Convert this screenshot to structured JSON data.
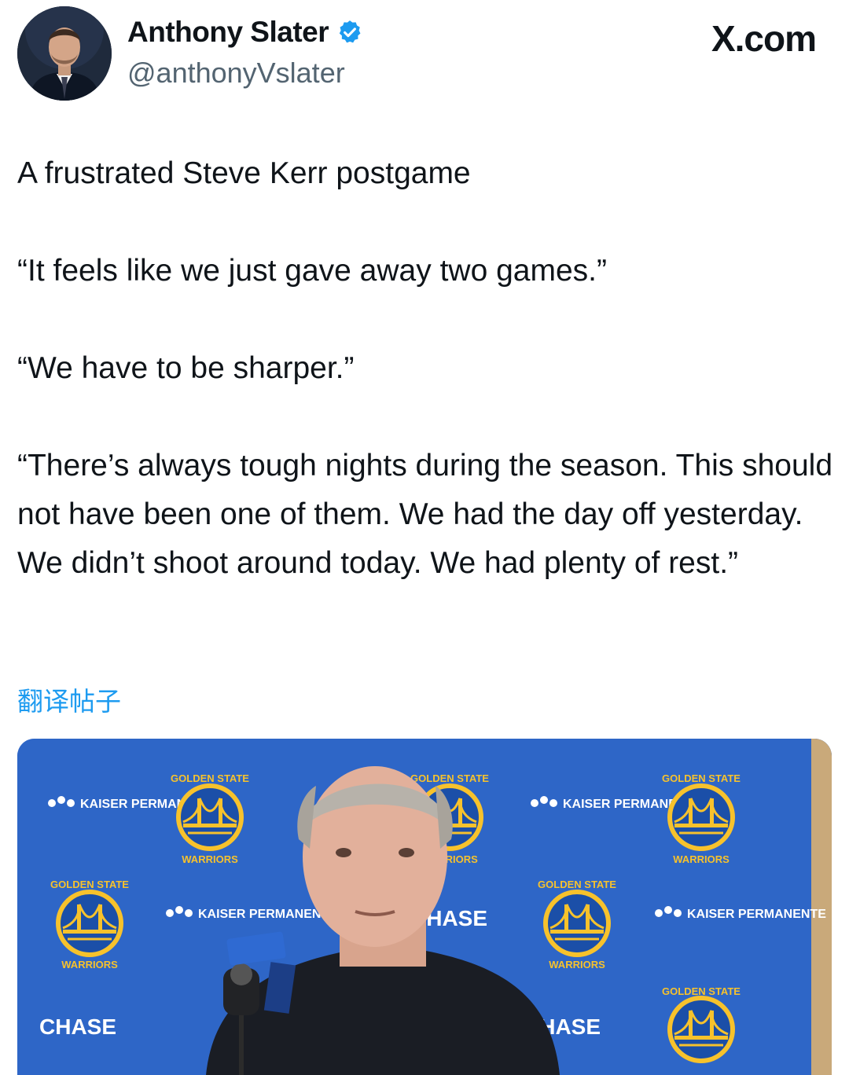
{
  "author": {
    "name": "Anthony Slater",
    "handle": "@anthonyVslater",
    "verified": true,
    "avatar_icon": "profile-photo"
  },
  "site_label": "X.com",
  "tweet": {
    "paragraphs": [
      "A frustrated Steve Kerr postgame",
      "“It feels like we just gave away two games.”",
      "“We have to be sharper.”",
      "“There’s always tough nights during the season. This should not have been one of them. We had the day off yesterday. We didn’t shoot around today. We had plenty of rest.”"
    ]
  },
  "translate_link": "翻译帖子",
  "media": {
    "backdrop": {
      "sponsor_1": "KAISER PERMANENTE",
      "sponsor_2": "CHASE",
      "team_top": "GOLDEN STATE",
      "team_bottom": "WARRIORS"
    },
    "colors": {
      "backdrop_blue": "#2e66c7",
      "logo_gold": "#f7c22c",
      "logo_blue": "#1b4fa8"
    }
  },
  "colors": {
    "link_blue": "#1d9bf0",
    "verified_blue": "#1d9bf0",
    "secondary_text": "#536471"
  }
}
